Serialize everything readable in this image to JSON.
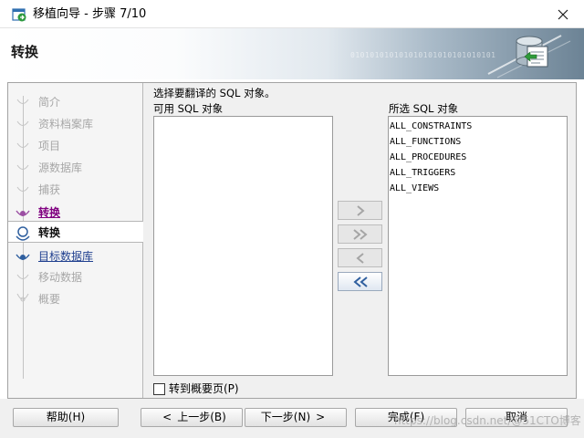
{
  "window": {
    "title": "移植向导 - 步骤 7/10",
    "close_glyph": "✕"
  },
  "banner": {
    "title": "转换",
    "digits": "010101010101010101010101010101"
  },
  "steps": [
    {
      "label": "简介",
      "state": "disabled"
    },
    {
      "label": "资料档案库",
      "state": "disabled"
    },
    {
      "label": "项目",
      "state": "disabled"
    },
    {
      "label": "源数据库",
      "state": "disabled"
    },
    {
      "label": "捕获",
      "state": "disabled"
    },
    {
      "label": "转换",
      "state": "visited"
    },
    {
      "label": "转换",
      "state": "current"
    },
    {
      "label": "目标数据库",
      "state": "link"
    },
    {
      "label": "移动数据",
      "state": "disabled"
    },
    {
      "label": "概要",
      "state": "disabled"
    }
  ],
  "content": {
    "instruction": "选择要翻译的 SQL 对象。",
    "available_label": "可用 SQL 对象",
    "selected_label": "所选 SQL 对象",
    "available_items": [],
    "selected_items": [
      "ALL_CONSTRAINTS",
      "ALL_FUNCTIONS",
      "ALL_PROCEDURES",
      "ALL_TRIGGERS",
      "ALL_VIEWS"
    ]
  },
  "shuttle": {
    "move_right": {
      "icon": "chevron-right-icon",
      "enabled": false
    },
    "move_all_right": {
      "icon": "double-chevron-right-icon",
      "enabled": false
    },
    "move_left": {
      "icon": "chevron-left-icon",
      "enabled": false
    },
    "move_all_left": {
      "icon": "double-chevron-left-icon",
      "enabled": true
    }
  },
  "summary_checkbox": {
    "label": "转到概要页(P)",
    "checked": false
  },
  "buttons": {
    "help": "帮助(H)",
    "back": "上一步(B)",
    "back_arrow": "<",
    "next": "下一步(N)",
    "next_arrow": ">",
    "finish": "完成(F)",
    "cancel": "取消"
  },
  "watermark": "https://blog.csdn.net/@51CTO博客",
  "colors": {
    "visited_link": "#800080",
    "link": "#1f3f8f",
    "disabled_text": "#a7a7a7",
    "active_arrow": "#2f5f9f"
  }
}
